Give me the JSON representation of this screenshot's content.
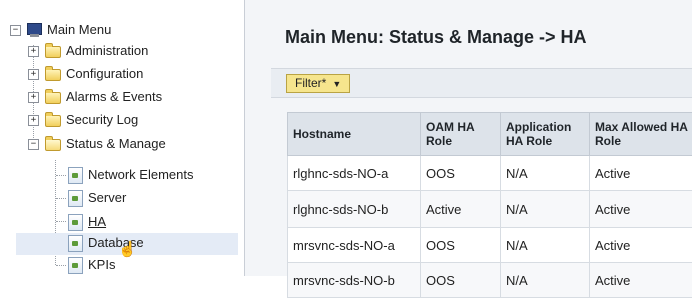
{
  "tree": {
    "root": {
      "label": "Main Menu",
      "expander": "−",
      "icon": "monitor-icon"
    },
    "items": [
      {
        "label": "Administration",
        "expander": "+",
        "icon": "folder-icon"
      },
      {
        "label": "Configuration",
        "expander": "+",
        "icon": "folder-icon"
      },
      {
        "label": "Alarms & Events",
        "expander": "+",
        "icon": "folder-icon"
      },
      {
        "label": "Security Log",
        "expander": "+",
        "icon": "folder-icon"
      },
      {
        "label": "Status & Manage",
        "expander": "−",
        "icon": "folder-open-icon",
        "children": [
          {
            "label": "Network Elements",
            "icon": "page-icon"
          },
          {
            "label": "Server",
            "icon": "page-icon"
          },
          {
            "label": "HA",
            "icon": "page-icon",
            "selected": true
          },
          {
            "label": "Database",
            "icon": "page-icon"
          },
          {
            "label": "KPIs",
            "icon": "page-icon"
          }
        ]
      }
    ]
  },
  "main": {
    "title": "Main Menu: Status & Manage -> HA",
    "filter_label": "Filter*",
    "filter_caret": "▼",
    "table": {
      "headers": [
        "Hostname",
        "OAM HA Role",
        "Application HA Role",
        "Max Allowed HA Role"
      ],
      "rows": [
        [
          "rlghnc-sds-NO-a",
          "OOS",
          "N/A",
          "Active"
        ],
        [
          "rlghnc-sds-NO-b",
          "Active",
          "N/A",
          "Active"
        ],
        [
          "mrsvnc-sds-NO-a",
          "OOS",
          "N/A",
          "Active"
        ],
        [
          "mrsvnc-sds-NO-b",
          "OOS",
          "N/A",
          "Active"
        ]
      ]
    }
  },
  "colors": {
    "filter_bg": "#f6e58d",
    "header_bg": "#dde3ea",
    "selection_bg": "#e4ebf6"
  }
}
